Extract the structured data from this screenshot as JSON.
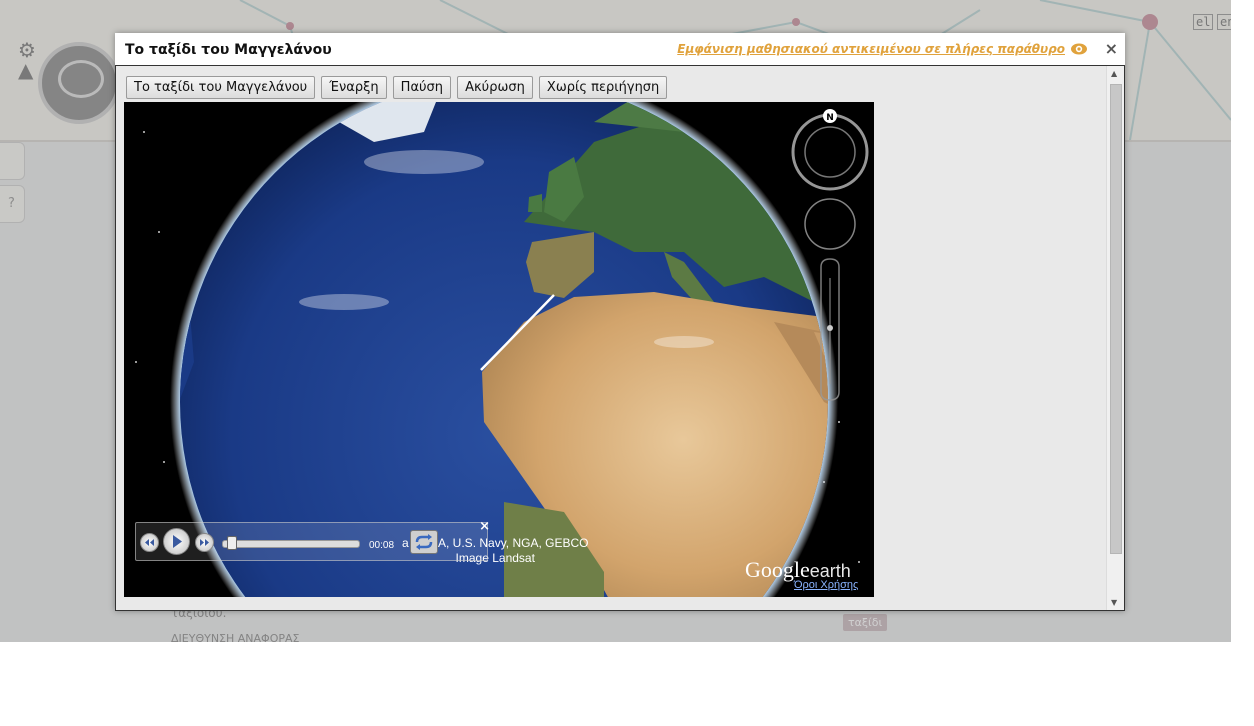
{
  "background": {
    "lang_el": "el",
    "lang_en": "en",
    "side_hint": "?",
    "text_line1": "ταξιδιού.",
    "text_line2": "ΔΙΕΥΘΥΝΣΗ ΑΝΑΦΟΡΑΣ",
    "badge": "ταξίδι"
  },
  "modal": {
    "title": "Το ταξίδι του Μαγγελάνου",
    "fullscreen_link": "Εμφάνιση μαθησιακού αντικειμένου σε πλήρες παράθυρο",
    "close": "×",
    "accent_color": "#e0a23c"
  },
  "toolbar": {
    "buttons": [
      {
        "label": "Το ταξίδι του Μαγγελάνου"
      },
      {
        "label": "Έναρξη"
      },
      {
        "label": "Παύση"
      },
      {
        "label": "Ακύρωση"
      },
      {
        "label": "Χωρίς περιήγηση"
      }
    ]
  },
  "viewer": {
    "compass_label": "N",
    "media": {
      "time": "00:08",
      "close": "×",
      "progress": 0.04
    },
    "credits_line1": "a NOAA, U.S. Navy, NGA, GEBCO",
    "credits_line2": "Image Landsat",
    "logo_google": "Google",
    "logo_earth": "earth",
    "terms": "Όροι Χρήσης"
  }
}
